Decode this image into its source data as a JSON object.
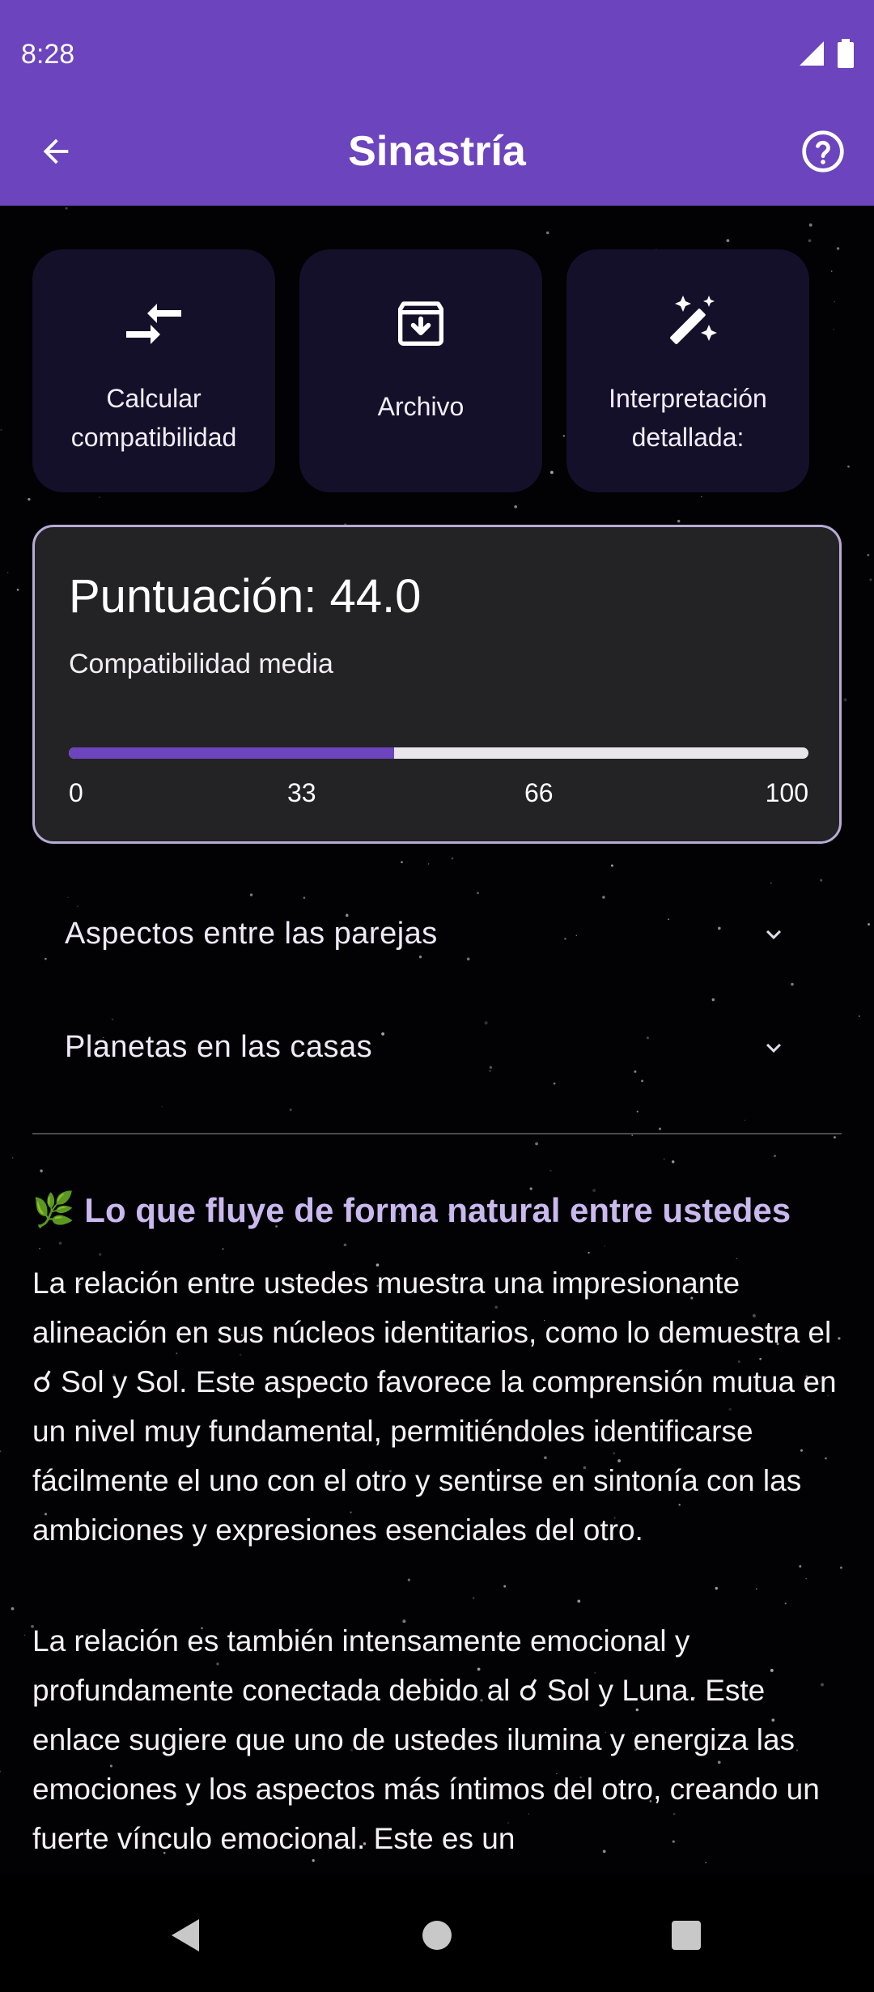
{
  "status_bar": {
    "time": "8:28",
    "icons": [
      "signal-icon",
      "battery-icon"
    ]
  },
  "app_bar": {
    "title": "Sinastría",
    "back_icon": "arrow-back-icon",
    "help_icon": "help-circle-icon",
    "color": "#6c44bd"
  },
  "actions": [
    {
      "label": "Calcular compatibilidad",
      "icon": "compare-arrows-icon"
    },
    {
      "label": "Archivo",
      "icon": "archive-icon"
    },
    {
      "label": "Interpretación detallada:",
      "icon": "magic-wand-icon"
    }
  ],
  "score": {
    "title": "Puntuación: 44.0",
    "subtitle": "Compatibilidad media",
    "value": 44.0,
    "max": 100,
    "ticks": [
      "0",
      "33",
      "66",
      "100"
    ]
  },
  "expanders": [
    {
      "label": "Aspectos entre las parejas"
    },
    {
      "label": "Planetas en las casas"
    }
  ],
  "content": {
    "heading_emoji": "🌿",
    "heading": "Lo que fluye de forma natural entre ustedes",
    "paragraphs": [
      "La relación entre ustedes muestra una impresionante alineación en sus núcleos identitarios, como lo demuestra el ☌ Sol y Sol. Este aspecto favorece la comprensión mutua en un nivel muy fundamental, permitiéndoles identificarse fácilmente el uno con el otro y sentirse en sintonía con las ambiciones y expresiones esenciales del otro.",
      "La relación es también intensamente emocional y profundamente conectada debido al ☌ Sol y Luna. Este enlace sugiere que uno de ustedes ilumina y energiza las emociones y los aspectos más íntimos del otro, creando un fuerte vínculo emocional. Este es un"
    ]
  },
  "nav_bar": {
    "buttons": [
      "back-triangle-icon",
      "home-circle-icon",
      "recents-square-icon"
    ]
  }
}
